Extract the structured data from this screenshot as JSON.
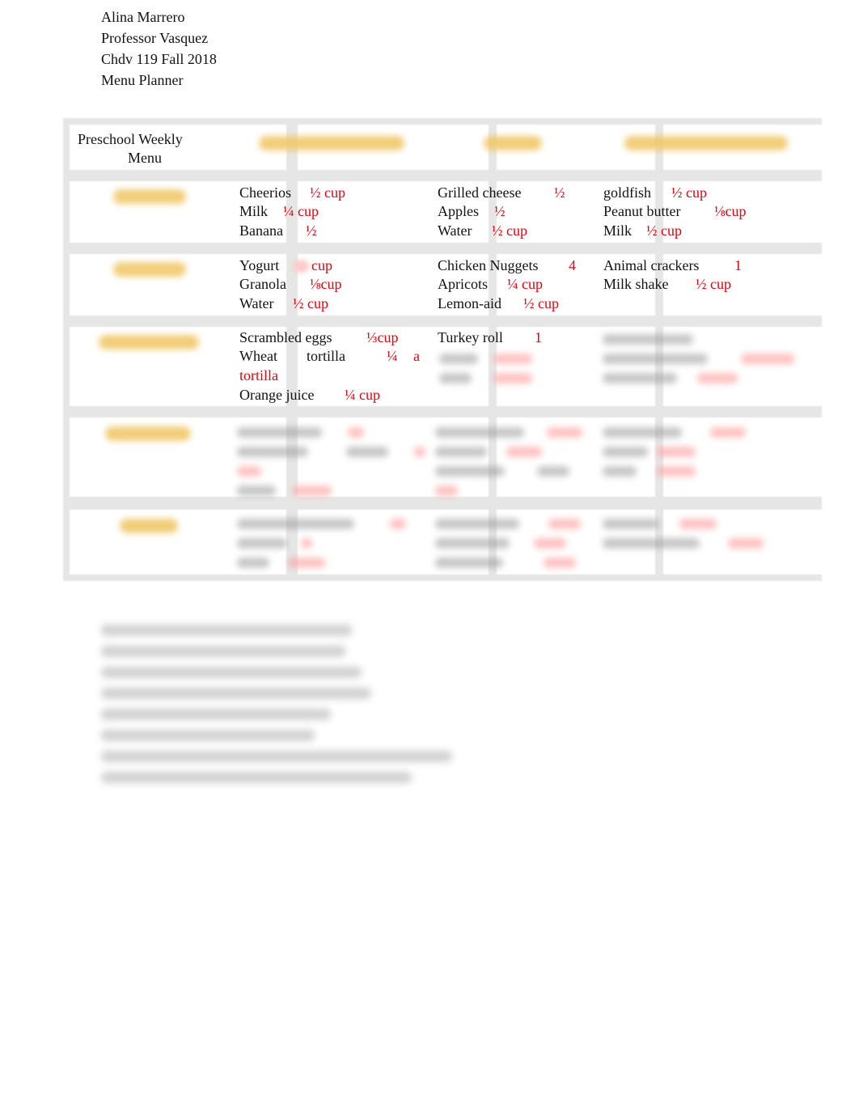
{
  "header": {
    "student_name": "Alina Marrero",
    "professor": "Professor Vasquez",
    "course": "Chdv 119 Fall 2018",
    "assignment": "Menu Planner"
  },
  "menu_table": {
    "title": "Preschool Weekly Menu",
    "title_line1": "Preschool Weekly",
    "title_line2": "Menu",
    "column_headers": [
      "[obscured]",
      "[obscured]",
      "[obscured]"
    ],
    "row_headers": [
      "[obscured]",
      "[obscured]",
      "[obscured]",
      "[obscured]",
      "[obscured]"
    ],
    "rows": [
      {
        "cells": [
          {
            "items": [
              {
                "food": "Cheerios",
                "qty": "½ cup"
              },
              {
                "food": "Milk",
                "qty": "¼ cup"
              },
              {
                "food": "Banana",
                "qty": "½"
              }
            ]
          },
          {
            "items": [
              {
                "food": "Grilled cheese",
                "qty": "½"
              },
              {
                "food": "Apples",
                "qty": "½"
              },
              {
                "food": "Water",
                "qty": "½ cup"
              }
            ]
          },
          {
            "items": [
              {
                "food": "goldfish",
                "qty": "½ cup"
              },
              {
                "food": "Peanut butter",
                "qty": "⅛cup"
              },
              {
                "food": "Milk",
                "qty": "½ cup"
              }
            ]
          }
        ]
      },
      {
        "cells": [
          {
            "items": [
              {
                "food": "Yogurt",
                "qty": "cup"
              },
              {
                "food": "Granola",
                "qty": "⅛cup"
              },
              {
                "food": "Water",
                "qty": "½ cup"
              }
            ]
          },
          {
            "items": [
              {
                "food": "Chicken Nuggets",
                "qty": "4"
              },
              {
                "food": "Apricots",
                "qty": "¼ cup"
              },
              {
                "food": "Lemon-aid",
                "qty": "½ cup"
              }
            ]
          },
          {
            "items": [
              {
                "food": "Animal crackers",
                "qty": "1"
              },
              {
                "food": "Milk shake",
                "qty": "½ cup"
              }
            ]
          }
        ]
      },
      {
        "cells": [
          {
            "items": [
              {
                "food": "Scrambled eggs",
                "qty": "⅓cup"
              },
              {
                "food": "Wheat tortilla",
                "qty": "¼ a tortilla",
                "qty_part1": "¼",
                "qty_part2": "a",
                "qty_wrap": "tortilla",
                "food_part1": "Wheat",
                "food_part2": "tortilla"
              },
              {
                "food": "Orange juice",
                "qty": "¼ cup"
              }
            ]
          },
          {
            "items": [
              {
                "food": "Turkey roll",
                "qty": "1"
              }
            ],
            "obscured_lines": 2
          },
          {
            "items": [],
            "obscured_lines": 3
          }
        ]
      },
      {
        "cells": [
          {
            "items": [],
            "obscured_lines": 4
          },
          {
            "items": [],
            "obscured_lines": 4
          },
          {
            "items": [],
            "obscured_lines": 3
          }
        ]
      },
      {
        "cells": [
          {
            "items": [],
            "obscured_lines": 3
          },
          {
            "items": [],
            "obscured_lines": 3
          },
          {
            "items": [],
            "obscured_lines": 2
          }
        ]
      }
    ]
  },
  "notes": {
    "obscured_lines": 8
  },
  "colors": {
    "quantity_red": "#e8000d",
    "header_gold": "#f0c86a",
    "grid_gray": "#e6e6e6"
  }
}
